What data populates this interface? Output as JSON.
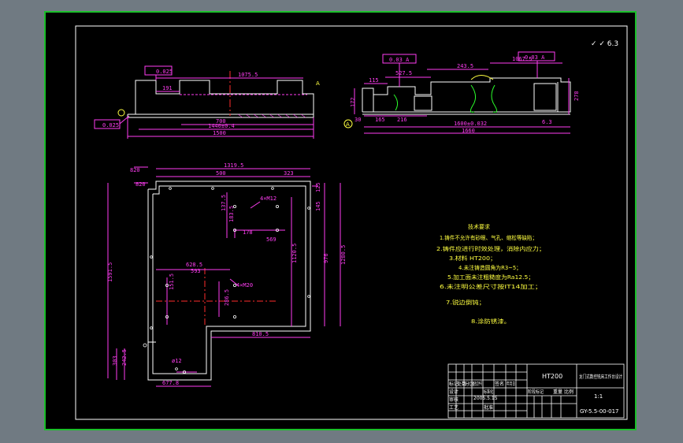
{
  "views": {
    "front": {
      "dims": [
        "1075.5",
        "191",
        "700",
        "1440±0.4",
        "1500"
      ],
      "tolerances": [
        "0.025",
        "0.025"
      ],
      "datum": "A"
    },
    "side": {
      "dims": [
        "527.5",
        "115",
        "243.5",
        "1067.5",
        "172",
        "165",
        "216",
        "1600±0.032",
        "1660",
        "278",
        "30"
      ],
      "tolerances": [
        "0.03 A",
        "0.03 A"
      ],
      "roughness": "6.3",
      "datum": "A"
    },
    "plan": {
      "dims": [
        "1319.5",
        "500",
        "323",
        "820",
        "820",
        "145",
        "125",
        "4×M12",
        "137.5",
        "183.5",
        "178",
        "569",
        "1120.5",
        "976",
        "1280.5",
        "1591.5",
        "628.5",
        "593",
        "151.5",
        "4×M20",
        "286.5",
        "810.5",
        "303",
        "242.5",
        "677.8",
        "ø12"
      ]
    },
    "corner_symbol": "✓ ✓ 6.3"
  },
  "notes": {
    "lines": [
      "技术要求",
      "1.铸件不允许有砂眼、气孔、缩松等缺陷；",
      "2.铸件应进行时效处理，消除内应力；",
      "3.材料 HT200；",
      "4.未注铸造圆角为R3~5；",
      "5.加工面未注粗糙度为Ra12.5；",
      "6.未注明公差尺寸按IT14加工；",
      "7.锐边倒钝；",
      "8.涂防锈漆。"
    ]
  },
  "title_block": {
    "material": "HT200",
    "title": "龙门式数控铣床工作台设计",
    "drawing_no": "GY-5.5-00-017",
    "scale": "1:1",
    "date": "2005.5.15",
    "labels": [
      "标记",
      "处数",
      "分区",
      "更改文件号",
      "签名",
      "年月日",
      "设计",
      "标准化",
      "审核",
      "工艺",
      "批准",
      "阶段标记",
      "重量",
      "比例"
    ]
  }
}
